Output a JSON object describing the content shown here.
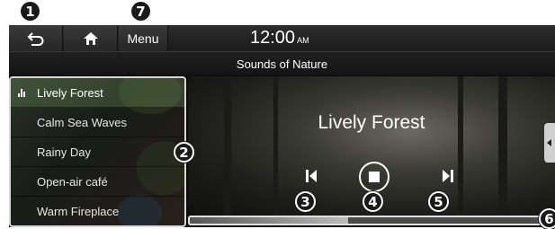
{
  "callouts": [
    "1",
    "2",
    "3",
    "4",
    "5",
    "6",
    "7"
  ],
  "topbar": {
    "menu_label": "Menu",
    "clock_time": "12:00",
    "clock_ampm": "AM"
  },
  "title": "Sounds of Nature",
  "list": {
    "items": [
      {
        "label": "Lively Forest",
        "active": true
      },
      {
        "label": "Calm Sea Waves",
        "active": false
      },
      {
        "label": "Rainy Day",
        "active": false
      },
      {
        "label": "Open-air café",
        "active": false
      },
      {
        "label": "Warm Fireplace",
        "active": false
      }
    ]
  },
  "player": {
    "now_playing": "Lively Forest",
    "progress": 0.44
  },
  "icons": {
    "back": "back-arrow-icon",
    "home": "home-icon",
    "prev": "previous-track-icon",
    "stop": "stop-icon",
    "next": "next-track-icon",
    "tab": "chevron-left-icon",
    "playing": "equalizer-icon"
  }
}
